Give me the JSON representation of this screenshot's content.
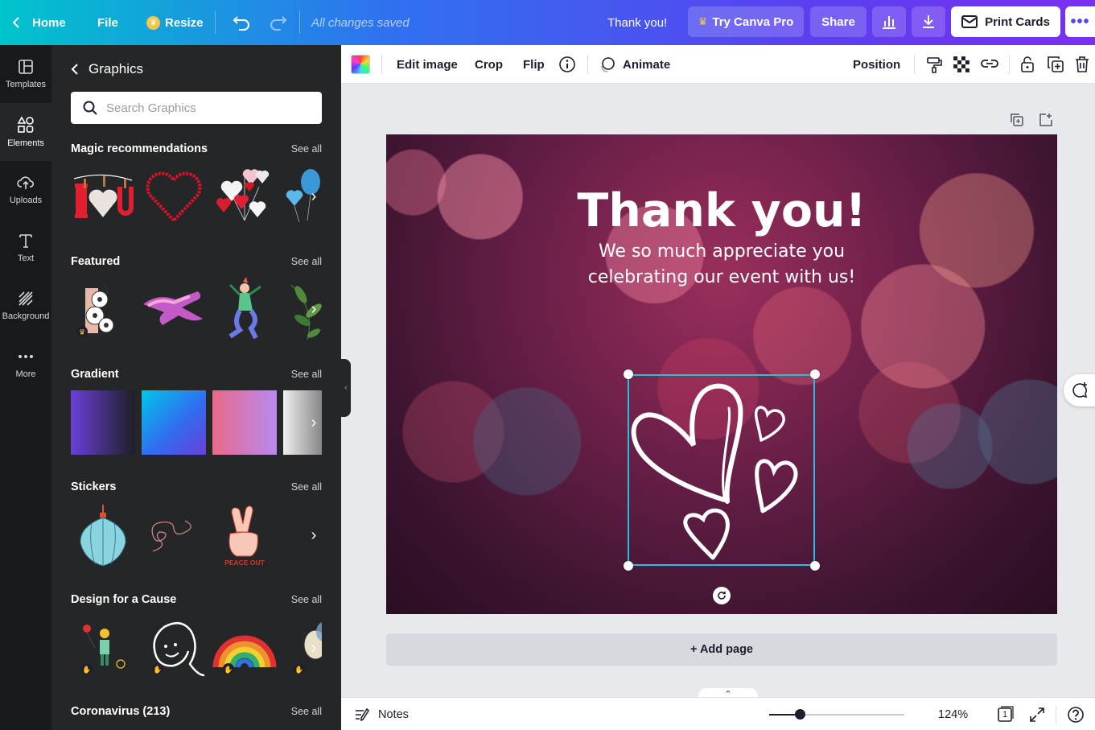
{
  "topbar": {
    "home": "Home",
    "file": "File",
    "resize": "Resize",
    "saved_status": "All changes saved",
    "doc_title": "Thank you!",
    "try_pro": "Try Canva Pro",
    "share": "Share",
    "print": "Print Cards",
    "more": "•••"
  },
  "rail": {
    "items": [
      {
        "label": "Templates"
      },
      {
        "label": "Elements"
      },
      {
        "label": "Uploads"
      },
      {
        "label": "Text"
      },
      {
        "label": "Background"
      },
      {
        "label": "More"
      }
    ]
  },
  "panel": {
    "title": "Graphics",
    "search_placeholder": "Search Graphics",
    "see_all": "See all",
    "sections": [
      {
        "title": "Magic recommendations"
      },
      {
        "title": "Featured"
      },
      {
        "title": "Gradient"
      },
      {
        "title": "Stickers"
      },
      {
        "title": "Design for a Cause"
      },
      {
        "title": "Coronavirus (213)"
      }
    ],
    "sticker_text": "PEACE OUT"
  },
  "toolbar": {
    "edit_image": "Edit image",
    "crop": "Crop",
    "flip": "Flip",
    "animate": "Animate",
    "position": "Position"
  },
  "canvas": {
    "title": "Thank you!",
    "subtitle_line1": "We so much appreciate you",
    "subtitle_line2": "celebrating our event with us!"
  },
  "add_page": "+ Add page",
  "bottom": {
    "notes": "Notes",
    "zoom_percent": "124%",
    "zoom_level": 0.23,
    "page_count": "1"
  },
  "colors": {
    "accent": "#5b3ff0",
    "selection": "#1fc2e0"
  }
}
